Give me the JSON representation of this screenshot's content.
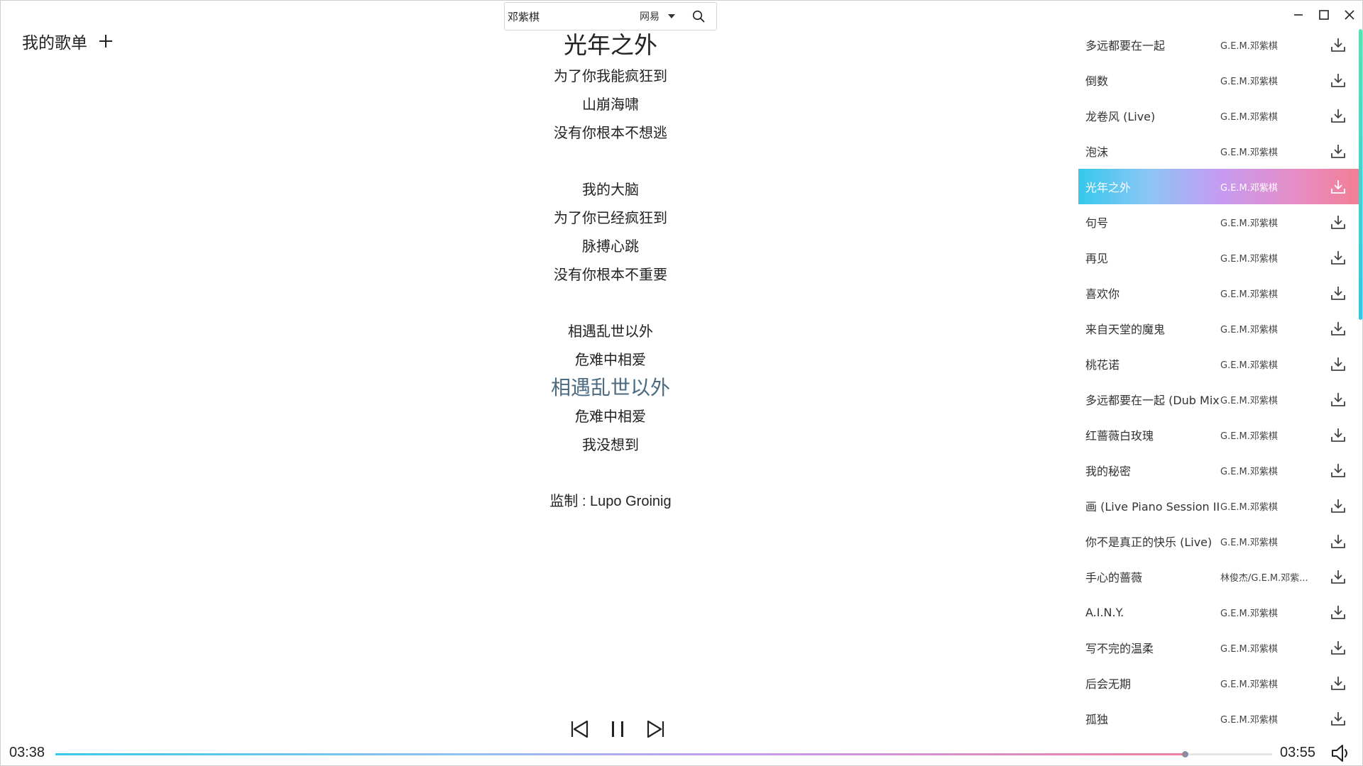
{
  "search": {
    "value": "邓紫棋",
    "source": "网易"
  },
  "playlists": {
    "title": "我的歌单"
  },
  "lyrics": {
    "title": "光年之外",
    "lines": [
      {
        "text": "为了你我能疯狂到",
        "type": "normal"
      },
      {
        "text": "山崩海啸",
        "type": "normal"
      },
      {
        "text": "没有你根本不想逃",
        "type": "normal"
      },
      {
        "text": "",
        "type": "blank"
      },
      {
        "text": "我的大脑",
        "type": "normal"
      },
      {
        "text": "为了你已经疯狂到",
        "type": "normal"
      },
      {
        "text": "脉搏心跳",
        "type": "normal"
      },
      {
        "text": "没有你根本不重要",
        "type": "normal"
      },
      {
        "text": "",
        "type": "blank"
      },
      {
        "text": "相遇乱世以外",
        "type": "normal"
      },
      {
        "text": "危难中相爱",
        "type": "normal"
      },
      {
        "text": "相遇乱世以外",
        "type": "current"
      },
      {
        "text": "危难中相爱",
        "type": "normal"
      },
      {
        "text": "我没想到",
        "type": "normal"
      },
      {
        "text": "",
        "type": "blank"
      },
      {
        "text": "监制 : Lupo Groinig",
        "type": "credit"
      }
    ]
  },
  "songs": [
    {
      "name": "多远都要在一起",
      "artist": "G.E.M.邓紫棋"
    },
    {
      "name": "倒数",
      "artist": "G.E.M.邓紫棋"
    },
    {
      "name": "龙卷风 (Live)",
      "artist": "G.E.M.邓紫棋"
    },
    {
      "name": "泡沫",
      "artist": "G.E.M.邓紫棋"
    },
    {
      "name": "光年之外",
      "artist": "G.E.M.邓紫棋",
      "active": true
    },
    {
      "name": "句号",
      "artist": "G.E.M.邓紫棋"
    },
    {
      "name": "再见",
      "artist": "G.E.M.邓紫棋"
    },
    {
      "name": "喜欢你",
      "artist": "G.E.M.邓紫棋"
    },
    {
      "name": "来自天堂的魔鬼",
      "artist": "G.E.M.邓紫棋"
    },
    {
      "name": "桃花诺",
      "artist": "G.E.M.邓紫棋"
    },
    {
      "name": "多远都要在一起 (Dub Mix)",
      "artist": "G.E.M.邓紫棋"
    },
    {
      "name": "红蔷薇白玫瑰",
      "artist": "G.E.M.邓紫棋"
    },
    {
      "name": "我的秘密",
      "artist": "G.E.M.邓紫棋"
    },
    {
      "name": "画 (Live Piano Session II)",
      "artist": "G.E.M.邓紫棋"
    },
    {
      "name": "你不是真正的快乐 (Live)",
      "artist": "G.E.M.邓紫棋"
    },
    {
      "name": "手心的蔷薇",
      "artist": "林俊杰/G.E.M.邓紫..."
    },
    {
      "name": "A.I.N.Y.",
      "artist": "G.E.M.邓紫棋"
    },
    {
      "name": "写不完的温柔",
      "artist": "G.E.M.邓紫棋"
    },
    {
      "name": "后会无期",
      "artist": "G.E.M.邓紫棋"
    },
    {
      "name": "孤独",
      "artist": "G.E.M.邓紫棋"
    }
  ],
  "player": {
    "current_time": "03:38",
    "total_time": "03:55",
    "progress": 0.928,
    "state": "playing"
  }
}
